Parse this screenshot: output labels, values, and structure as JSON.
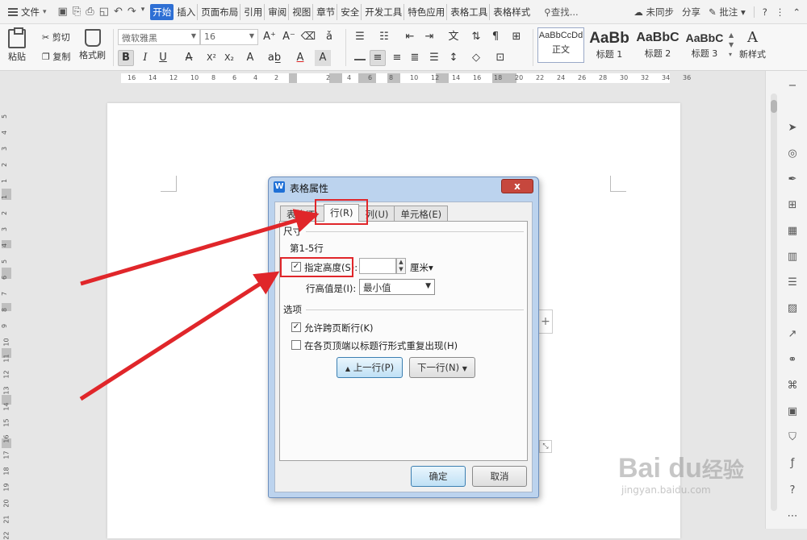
{
  "menubar": {
    "file_label": "文件",
    "tabs": [
      "开始",
      "插入",
      "页面布局",
      "引用",
      "审阅",
      "视图",
      "章节",
      "安全",
      "开发工具",
      "特色应用",
      "表格工具",
      "表格样式"
    ],
    "search_label": "查找...",
    "sync_label": "未同步",
    "share_label": "分享",
    "comment_label": "批注",
    "help_label": "?"
  },
  "ribbon": {
    "paste_label": "粘贴",
    "cut_label": "剪切",
    "copy_label": "复制",
    "format_painter_label": "格式刷",
    "font_name": "微软雅黑",
    "font_size": "16",
    "styles": [
      {
        "sample": "AaBbCcDd",
        "name": "正文"
      },
      {
        "sample": "AaBb",
        "name": "标题 1"
      },
      {
        "sample": "AaBbC",
        "name": "标题 2"
      },
      {
        "sample": "AaBbC",
        "name": "标题 3"
      }
    ],
    "new_style_label": "新样式"
  },
  "hruler_ticks": [
    "16",
    "14",
    "12",
    "10",
    "8",
    "6",
    "4",
    "2",
    "2",
    "4",
    "6",
    "8",
    "10",
    "12",
    "14",
    "16",
    "18",
    "20",
    "22",
    "24",
    "26",
    "28",
    "30",
    "32",
    "34",
    "36"
  ],
  "vruler_ticks": [
    "5",
    "4",
    "3",
    "2",
    "1",
    "1",
    "2",
    "3",
    "4",
    "5",
    "6",
    "7",
    "8",
    "9",
    "10",
    "11",
    "12",
    "13",
    "14",
    "15",
    "16",
    "17",
    "18",
    "19",
    "20",
    "21",
    "22"
  ],
  "dialog": {
    "title": "表格属性",
    "close_label": "x",
    "tabs": [
      "表格(T)",
      "行(R)",
      "列(U)",
      "单元格(E)"
    ],
    "size_section": "尺寸",
    "rows_label": "第1-5行",
    "specify_height_label": "指定高度(S):",
    "specify_height_checked": true,
    "height_value": "",
    "unit_label": "厘米",
    "row_height_is_label": "行高值是(I):",
    "row_height_mode": "最小值",
    "options_section": "选项",
    "allow_break_label": "允许跨页断行(K)",
    "allow_break_checked": true,
    "repeat_header_label": "在各页顶端以标题行形式重复出现(H)",
    "repeat_header_checked": false,
    "prev_row_label": "上一行(P)",
    "next_row_label": "下一行(N)",
    "ok_label": "确定",
    "cancel_label": "取消"
  },
  "watermark": {
    "brand": "Bai du",
    "suffix": "经验",
    "url": "jingyan.baidu.com"
  },
  "colors": {
    "accent_tab": "#2e6fd4",
    "annotation_red": "#e0262a",
    "dialog_frame": "#bcd3ee"
  }
}
